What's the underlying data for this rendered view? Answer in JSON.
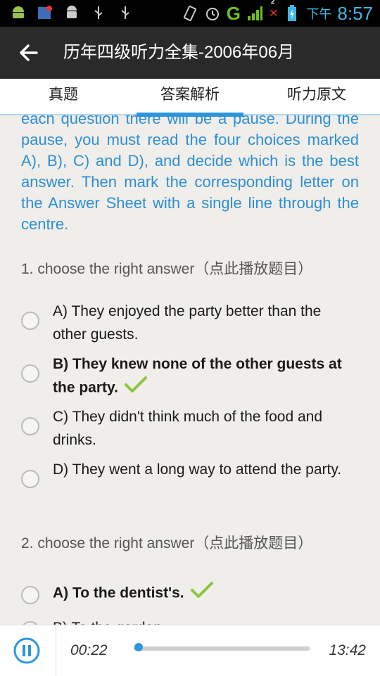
{
  "status_bar": {
    "network_letter": "G",
    "notif_count": "2",
    "ampm": "下午",
    "time": "8:57",
    "icons": [
      "android-icon",
      "app-notification-icon",
      "android-robot-icon",
      "usb-icon",
      "usb-icon",
      "vibrate-icon",
      "alarm-icon",
      "signal-icon",
      "no-signal-icon",
      "battery-icon"
    ]
  },
  "action_bar": {
    "title": "历年四级听力全集-2006年06月",
    "back_icon": "back-arrow-icon"
  },
  "tabs": [
    {
      "label": "真题",
      "active": false
    },
    {
      "label": "答案解析",
      "active": true
    },
    {
      "label": "听力原文",
      "active": false
    }
  ],
  "intro_text": "each question there will be a pause. During the pause, you must read the four choices marked A), B), C) and D), and decide which is the best answer. Then mark the corresponding letter on the Answer Sheet with a single line through the centre.",
  "questions": [
    {
      "prompt": "1. choose the right answer（点此播放题目）",
      "options": [
        {
          "text": "A) They enjoyed the party better than the other guests.",
          "correct": false
        },
        {
          "text": "B) They knew none of the other guests at the party.",
          "correct": true
        },
        {
          "text": "C) They didn't think much of the food and drinks.",
          "correct": false
        },
        {
          "text": "D) They went a long way to attend the party.",
          "correct": false
        }
      ]
    },
    {
      "prompt": "2. choose the right answer（点此播放题目）",
      "options": [
        {
          "text": "A) To the dentist's.",
          "correct": true
        },
        {
          "text": "B) To the garden.",
          "correct": false
        }
      ]
    }
  ],
  "player": {
    "elapsed": "00:22",
    "total": "13:42",
    "progress": 0.027,
    "pause_icon": "pause-icon"
  },
  "colors": {
    "accent": "#2b97dc",
    "check": "#8dc63f",
    "actionbar": "#2a2a2a"
  }
}
